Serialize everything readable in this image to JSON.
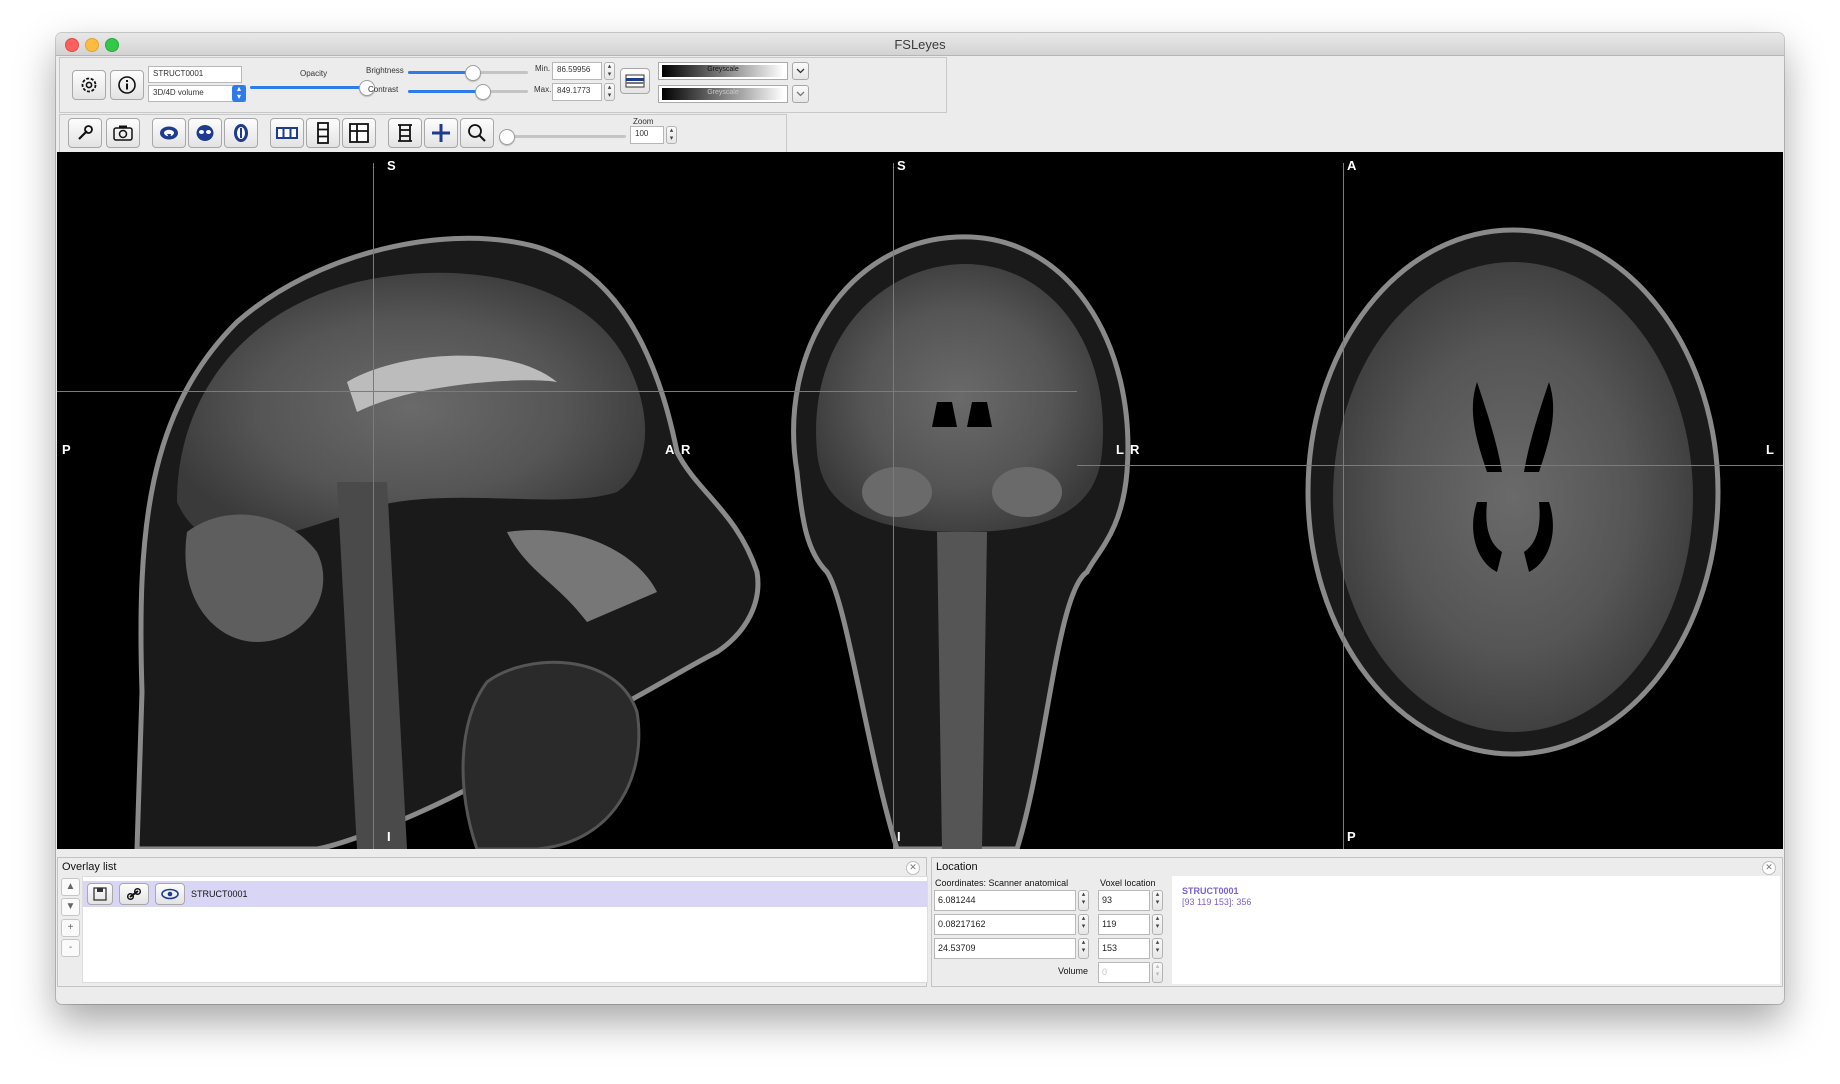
{
  "window": {
    "title": "FSLeyes"
  },
  "toolbar": {
    "overlay_name": "STRUCT0001",
    "overlay_type": "3D/4D volume",
    "opacity_label": "Opacity",
    "opacity_value": 0.97,
    "brightness_label": "Brightness",
    "brightness_value": 0.53,
    "contrast_label": "Contrast",
    "contrast_value": 0.62,
    "min_label": "Min.",
    "min_value": "86.59956",
    "max_label": "Max.",
    "max_value": "849.1773",
    "cmap_primary": "Greyscale",
    "cmap_secondary": "Greyscale"
  },
  "toolbar2": {
    "zoom_label": "Zoom",
    "zoom_value": "100",
    "zoom_fraction": 0.0
  },
  "views": {
    "sagittal": {
      "top": "S",
      "bottom": "I",
      "left": "P",
      "right": "A"
    },
    "coronal": {
      "top": "S",
      "bottom": "I",
      "left": "R",
      "right": "L"
    },
    "axial": {
      "top": "A",
      "bottom": "P",
      "left": "R",
      "right": "L"
    }
  },
  "crosshair_color": "#18c018",
  "overlay_list": {
    "title": "Overlay list",
    "items": [
      {
        "name": "STRUCT0001"
      }
    ],
    "buttons": {
      "up": "▲",
      "down": "▼",
      "add": "+",
      "remove": "-"
    }
  },
  "location": {
    "title": "Location",
    "coords_label": "Coordinates: Scanner anatomical",
    "voxel_label": "Voxel location",
    "coords": [
      "6.081244",
      "0.08217162",
      "24.53709"
    ],
    "voxels": [
      "93",
      "119",
      "153"
    ],
    "volume_label": "Volume",
    "volume_value": "0",
    "info_name": "STRUCT0001",
    "info_value": "[93 119 153]: 356"
  }
}
